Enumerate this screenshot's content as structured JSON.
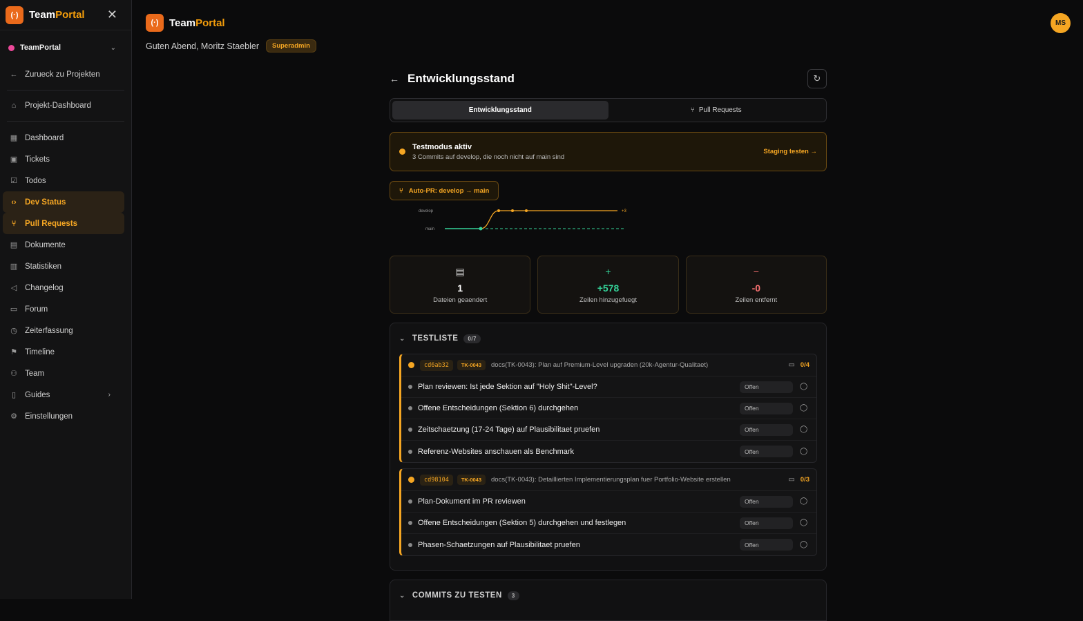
{
  "app": {
    "brand_a": "Team",
    "brand_b": "Portal",
    "logo": "(·)"
  },
  "sidebar": {
    "project": "TeamPortal",
    "back": "Zurueck zu Projekten",
    "overview": "Projekt-Dashboard",
    "items": [
      {
        "label": "Dashboard",
        "icon": "▦"
      },
      {
        "label": "Tickets",
        "icon": "▣"
      },
      {
        "label": "Todos",
        "icon": "☑"
      },
      {
        "label": "Dev Status",
        "icon": "‹›"
      },
      {
        "label": "Pull Requests",
        "icon": "⑂"
      },
      {
        "label": "Dokumente",
        "icon": "▤"
      },
      {
        "label": "Statistiken",
        "icon": "▥"
      },
      {
        "label": "Changelog",
        "icon": "◁"
      },
      {
        "label": "Forum",
        "icon": "▭"
      },
      {
        "label": "Zeiterfassung",
        "icon": "◷"
      },
      {
        "label": "Timeline",
        "icon": "⚑"
      },
      {
        "label": "Team",
        "icon": "⚇"
      },
      {
        "label": "Guides",
        "icon": "▯"
      },
      {
        "label": "Einstellungen",
        "icon": "⚙"
      }
    ]
  },
  "header": {
    "greeting": "Guten Abend, Moritz Staebler",
    "role": "Superadmin",
    "avatar": "MS"
  },
  "page": {
    "title": "Entwicklungsstand",
    "tabs": [
      "Entwicklungsstand",
      "Pull Requests"
    ],
    "testmode": {
      "title": "Testmodus aktiv",
      "sub": "3 Commits auf develop, die noch nicht auf main sind",
      "link": "Staging testen →"
    },
    "autopr": "Auto-PR: develop → main",
    "graph": {
      "develop": "develop",
      "main": "main",
      "ahead": "+3"
    },
    "stats": [
      {
        "value": "1",
        "label": "Dateien geaendert",
        "icon": "▤",
        "color": "#ffffff"
      },
      {
        "value": "+578",
        "label": "Zeilen hinzugefuegt",
        "icon": "+",
        "color": "#34d399"
      },
      {
        "value": "-0",
        "label": "Zeilen entfernt",
        "icon": "−",
        "color": "#f87171"
      }
    ],
    "testliste": {
      "title": "TESTLISTE",
      "count": "0/7",
      "groups": [
        {
          "sha": "cd6ab32",
          "ticket": "TK-0043",
          "msg": "docs(TK-0043): Plan auf Premium-Level upgraden (20k-Agentur-Qualitaet)",
          "progress": "0/4",
          "rows": [
            {
              "text": "Plan reviewen: Ist jede Sektion auf \"Holy Shit\"-Level?",
              "status": "Offen"
            },
            {
              "text": "Offene Entscheidungen (Sektion 6) durchgehen",
              "status": "Offen"
            },
            {
              "text": "Zeitschaetzung (17-24 Tage) auf Plausibilitaet pruefen",
              "status": "Offen"
            },
            {
              "text": "Referenz-Websites anschauen als Benchmark",
              "status": "Offen"
            }
          ]
        },
        {
          "sha": "cd98104",
          "ticket": "TK-0043",
          "msg": "docs(TK-0043): Detaillierten Implementierungsplan fuer Portfolio-Website erstellen",
          "progress": "0/3",
          "rows": [
            {
              "text": "Plan-Dokument im PR reviewen",
              "status": "Offen"
            },
            {
              "text": "Offene Entscheidungen (Sektion 5) durchgehen und festlegen",
              "status": "Offen"
            },
            {
              "text": "Phasen-Schaetzungen auf Plausibilitaet pruefen",
              "status": "Offen"
            }
          ]
        }
      ]
    },
    "commits": {
      "title": "COMMITS ZU TESTEN",
      "count": "3"
    }
  }
}
